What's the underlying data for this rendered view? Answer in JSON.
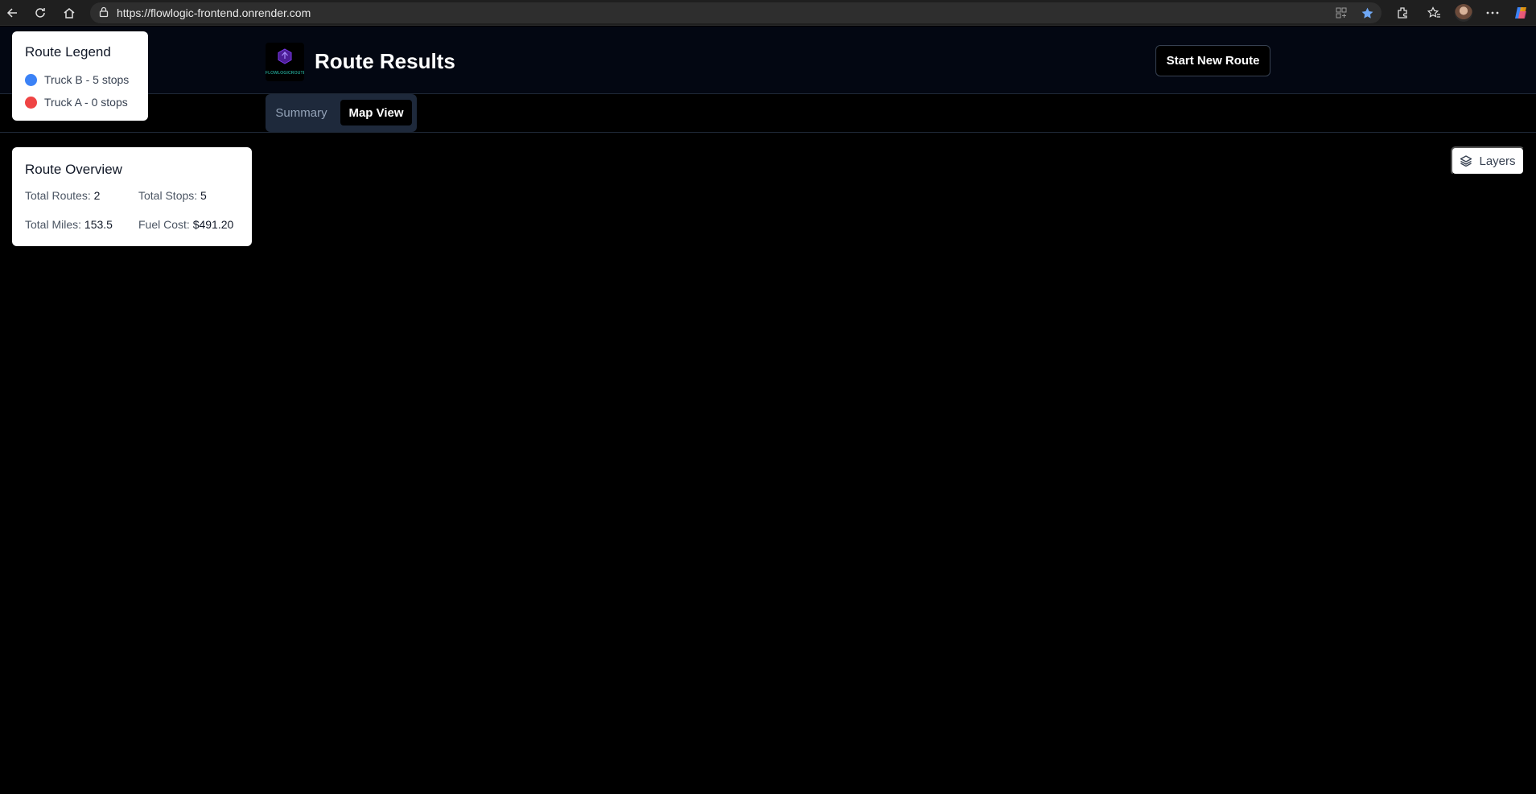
{
  "browser": {
    "url": "https://flowlogic-frontend.onrender.com",
    "icons": [
      "back-icon",
      "reload-icon",
      "home-icon",
      "lock-icon",
      "app-available-icon",
      "favorite-star-icon",
      "extensions-icon",
      "favorites-icon",
      "profile-avatar",
      "more-icon",
      "copilot-icon"
    ]
  },
  "header": {
    "logo_text": "FLOWLOGICROUTE",
    "title": "Route Results",
    "start_button": "Start New Route"
  },
  "tabs": [
    {
      "label": "Summary",
      "active": false
    },
    {
      "label": "Map View",
      "active": true
    }
  ],
  "legend": {
    "title": "Route Legend",
    "items": [
      {
        "label": "Truck B - 5 stops",
        "color": "#3b82f6"
      },
      {
        "label": "Truck A - 0 stops",
        "color": "#ef4444"
      }
    ]
  },
  "overview": {
    "title": "Route Overview",
    "stats": {
      "total_routes_label": "Total Routes:",
      "total_routes_value": "2",
      "total_stops_label": "Total Stops:",
      "total_stops_value": "5",
      "total_miles_label": "Total Miles:",
      "total_miles_value": "153.5",
      "fuel_cost_label": "Fuel Cost:",
      "fuel_cost_value": "$491.20"
    }
  },
  "map": {
    "layers_button": "Layers"
  },
  "colors": {
    "accent_blue": "#3b82f6",
    "accent_red": "#ef4444",
    "header_bg": "#030712"
  }
}
